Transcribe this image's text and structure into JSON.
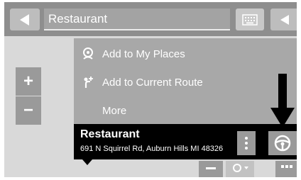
{
  "search": {
    "query": "Restaurant"
  },
  "zoom": {
    "in_label": "+",
    "out_label": "−"
  },
  "menu": {
    "items": [
      {
        "label": "Add to My Places",
        "icon": "place-pin-icon"
      },
      {
        "label": "Add to Current Route",
        "icon": "add-waypoint-icon"
      },
      {
        "label": "More",
        "icon": ""
      }
    ]
  },
  "place": {
    "name": "Restaurant",
    "address": "691 N Squirrel Rd, Auburn Hills MI 48326"
  },
  "colors": {
    "topbar": "#8e8e8e",
    "map": "#d9d9d9",
    "menu": "#a8a8a8",
    "infobar": "#000000"
  }
}
